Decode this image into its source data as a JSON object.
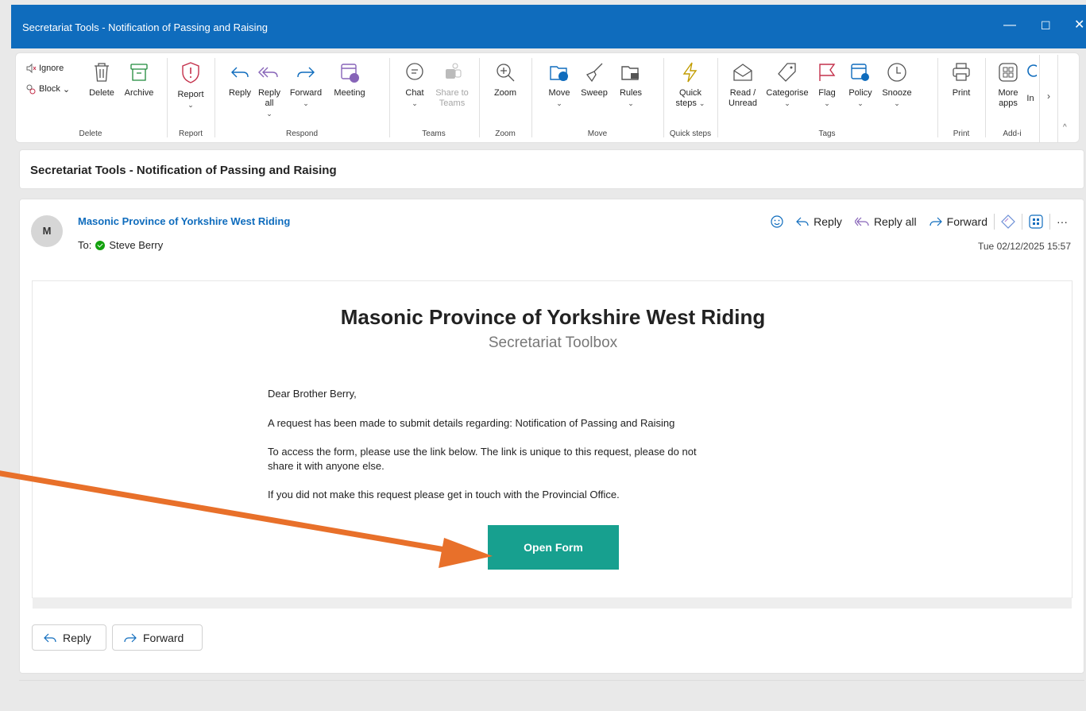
{
  "window": {
    "title": "Secretariat Tools - Notification of Passing and Raising",
    "min": "—",
    "max": "☐",
    "close": "✕"
  },
  "ribbon": {
    "delete_group": {
      "ignore": "Ignore",
      "block": "Block",
      "delete": "Delete",
      "archive": "Archive",
      "label": "Delete"
    },
    "report_group": {
      "report": "Report",
      "label": "Report"
    },
    "respond_group": {
      "reply": "Reply",
      "reply_all_1": "Reply",
      "reply_all_2": "all",
      "forward": "Forward",
      "meeting": "Meeting",
      "label": "Respond"
    },
    "teams_group": {
      "chat": "Chat",
      "share_1": "Share to",
      "share_2": "Teams",
      "label": "Teams"
    },
    "zoom_group": {
      "zoom": "Zoom",
      "label": "Zoom"
    },
    "move_group": {
      "move": "Move",
      "sweep": "Sweep",
      "rules": "Rules",
      "label": "Move"
    },
    "quick_group": {
      "quick_1": "Quick",
      "quick_2": "steps",
      "label": "Quick steps"
    },
    "tags_group": {
      "read_1": "Read /",
      "read_2": "Unread",
      "categorise": "Categorise",
      "flag": "Flag",
      "policy": "Policy",
      "snooze": "Snooze",
      "label": "Tags"
    },
    "print_group": {
      "print": "Print",
      "label": "Print"
    },
    "addin_group": {
      "more_1": "More",
      "more_2": "apps",
      "in": "In",
      "label": "Add-i"
    },
    "colors": {
      "accent": "#0f6cbd",
      "flag": "#c4314b"
    }
  },
  "subject": "Secretariat Tools - Notification of Passing and Raising",
  "message": {
    "avatar": "M",
    "sender": "Masonic Province of Yorkshire West Riding",
    "to_label": "To:",
    "to_name": "Steve Berry",
    "date": "Tue 02/12/2025 15:57",
    "actions": {
      "reply": "Reply",
      "reply_all": "Reply all",
      "forward": "Forward",
      "more": "···"
    }
  },
  "email": {
    "heading": "Masonic Province of Yorkshire West Riding",
    "subheading": "Secretariat Toolbox",
    "greeting": "Dear Brother Berry,",
    "p1": "A request has been made to submit details regarding: Notification of Passing and Raising",
    "p2a": "To access the form, please use the link below. The link is unique to this request, please do not",
    "p2b": "share it with anyone else.",
    "p3": "If you did not make this request please get in touch with the Provincial Office.",
    "button": "Open Form",
    "button_color": "#17a08f"
  },
  "footer": {
    "reply": "Reply",
    "forward": "Forward"
  },
  "annotation": {
    "arrow_color": "#e8702a"
  }
}
